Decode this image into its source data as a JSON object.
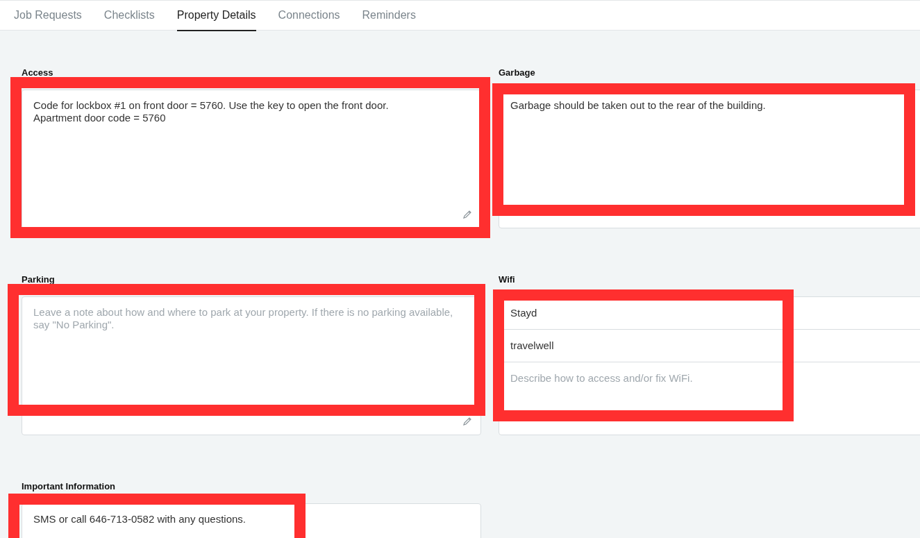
{
  "tabs": [
    {
      "label": "Job Requests",
      "selected": false
    },
    {
      "label": "Checklists",
      "selected": false
    },
    {
      "label": "Property Details",
      "selected": true
    },
    {
      "label": "Connections",
      "selected": false
    },
    {
      "label": "Reminders",
      "selected": false
    }
  ],
  "sections": [
    {
      "kind": "textarea",
      "label": "Access",
      "value": "Code for lockbox #1 on front door = 5760. Use the key to open the front door.\nApartment door code = 5760",
      "resize_handle": true
    },
    {
      "kind": "textarea",
      "label": "Garbage",
      "value": "Garbage should be taken out to the rear of the building.",
      "resize_handle": false
    },
    {
      "kind": "textarea",
      "label": "Parking",
      "placeholder": "Leave a note about how and where to park at your property. If there is no parking available, say \"No Parking\".",
      "resize_handle": true
    },
    {
      "kind": "wifi",
      "label": "Wifi",
      "rows": [
        {
          "value": "Stayd"
        },
        {
          "value": "travelwell"
        },
        {
          "placeholder": "Describe how to access and/or fix WiFi."
        }
      ]
    },
    {
      "kind": "textarea",
      "label": "Important Information",
      "value": "SMS or call 646-713-0582 with any questions.",
      "resize_handle": false
    }
  ]
}
